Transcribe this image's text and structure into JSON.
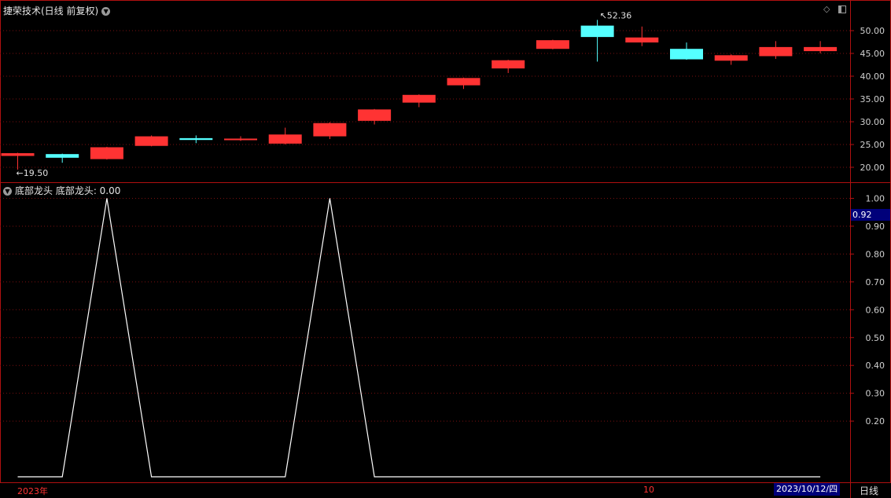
{
  "main_title": "捷荣技术(日线 前复权)",
  "indicator_title": "底部龙头 底部龙头: 0.00",
  "price_high_label": "52.36",
  "price_low_label": "19.50",
  "cursor_value": "0.92",
  "date_left": "2023年",
  "date_mid": "10",
  "date_right": "2023/10/12/四",
  "period_label": "日线",
  "colors": {
    "up": "#ff3333",
    "down": "#55ffff",
    "grid": "#7a1010",
    "line": "#ffffff"
  },
  "chart_data": [
    {
      "type": "candlestick",
      "title": "捷荣技术(日线 前复权)",
      "y_ticks": [
        "50.00",
        "45.00",
        "40.00",
        "35.00",
        "30.00",
        "25.00",
        "20.00"
      ],
      "ylim": [
        17.5,
        55.5
      ],
      "candles": [
        {
          "o": 22.5,
          "c": 23.1,
          "h": 23.2,
          "l": 19.5,
          "dir": "up"
        },
        {
          "o": 22.9,
          "c": 22.1,
          "h": 23.0,
          "l": 21.0,
          "dir": "down"
        },
        {
          "o": 21.8,
          "c": 24.4,
          "h": 24.5,
          "l": 21.7,
          "dir": "up"
        },
        {
          "o": 24.7,
          "c": 26.8,
          "h": 27.0,
          "l": 24.6,
          "dir": "up"
        },
        {
          "o": 26.4,
          "c": 26.0,
          "h": 27.0,
          "l": 25.3,
          "dir": "down"
        },
        {
          "o": 26.0,
          "c": 26.3,
          "h": 26.8,
          "l": 25.8,
          "dir": "up"
        },
        {
          "o": 25.2,
          "c": 27.2,
          "h": 28.7,
          "l": 25.0,
          "dir": "up"
        },
        {
          "o": 26.8,
          "c": 29.7,
          "h": 29.9,
          "l": 26.2,
          "dir": "up"
        },
        {
          "o": 30.2,
          "c": 32.7,
          "h": 32.8,
          "l": 29.4,
          "dir": "up"
        },
        {
          "o": 34.2,
          "c": 35.9,
          "h": 36.0,
          "l": 33.2,
          "dir": "up"
        },
        {
          "o": 38.0,
          "c": 39.6,
          "h": 39.7,
          "l": 37.2,
          "dir": "up"
        },
        {
          "o": 41.7,
          "c": 43.5,
          "h": 43.6,
          "l": 40.7,
          "dir": "up"
        },
        {
          "o": 46.0,
          "c": 47.9,
          "h": 48.0,
          "l": 45.9,
          "dir": "up"
        },
        {
          "o": 51.1,
          "c": 48.6,
          "h": 52.36,
          "l": 43.2,
          "dir": "down"
        },
        {
          "o": 47.4,
          "c": 48.5,
          "h": 50.9,
          "l": 46.6,
          "dir": "up"
        },
        {
          "o": 46.0,
          "c": 43.7,
          "h": 47.4,
          "l": 43.6,
          "dir": "down"
        },
        {
          "o": 43.4,
          "c": 44.6,
          "h": 44.8,
          "l": 42.5,
          "dir": "up"
        },
        {
          "o": 44.4,
          "c": 46.4,
          "h": 47.7,
          "l": 43.8,
          "dir": "up"
        },
        {
          "o": 45.5,
          "c": 46.4,
          "h": 47.7,
          "l": 45.0,
          "dir": "up"
        }
      ]
    },
    {
      "type": "line",
      "title": "底部龙头 底部龙头: 0.00",
      "y_ticks": [
        "1.00",
        "0.90",
        "0.80",
        "0.70",
        "0.60",
        "0.50",
        "0.40",
        "0.30",
        "0.20"
      ],
      "ylim": [
        -0.007,
        1.0
      ],
      "series": [
        {
          "values": [
            0,
            0,
            1,
            0,
            0,
            0,
            0,
            1,
            0,
            0,
            0,
            0,
            0,
            0,
            0,
            0,
            0,
            0,
            0
          ]
        }
      ]
    }
  ]
}
